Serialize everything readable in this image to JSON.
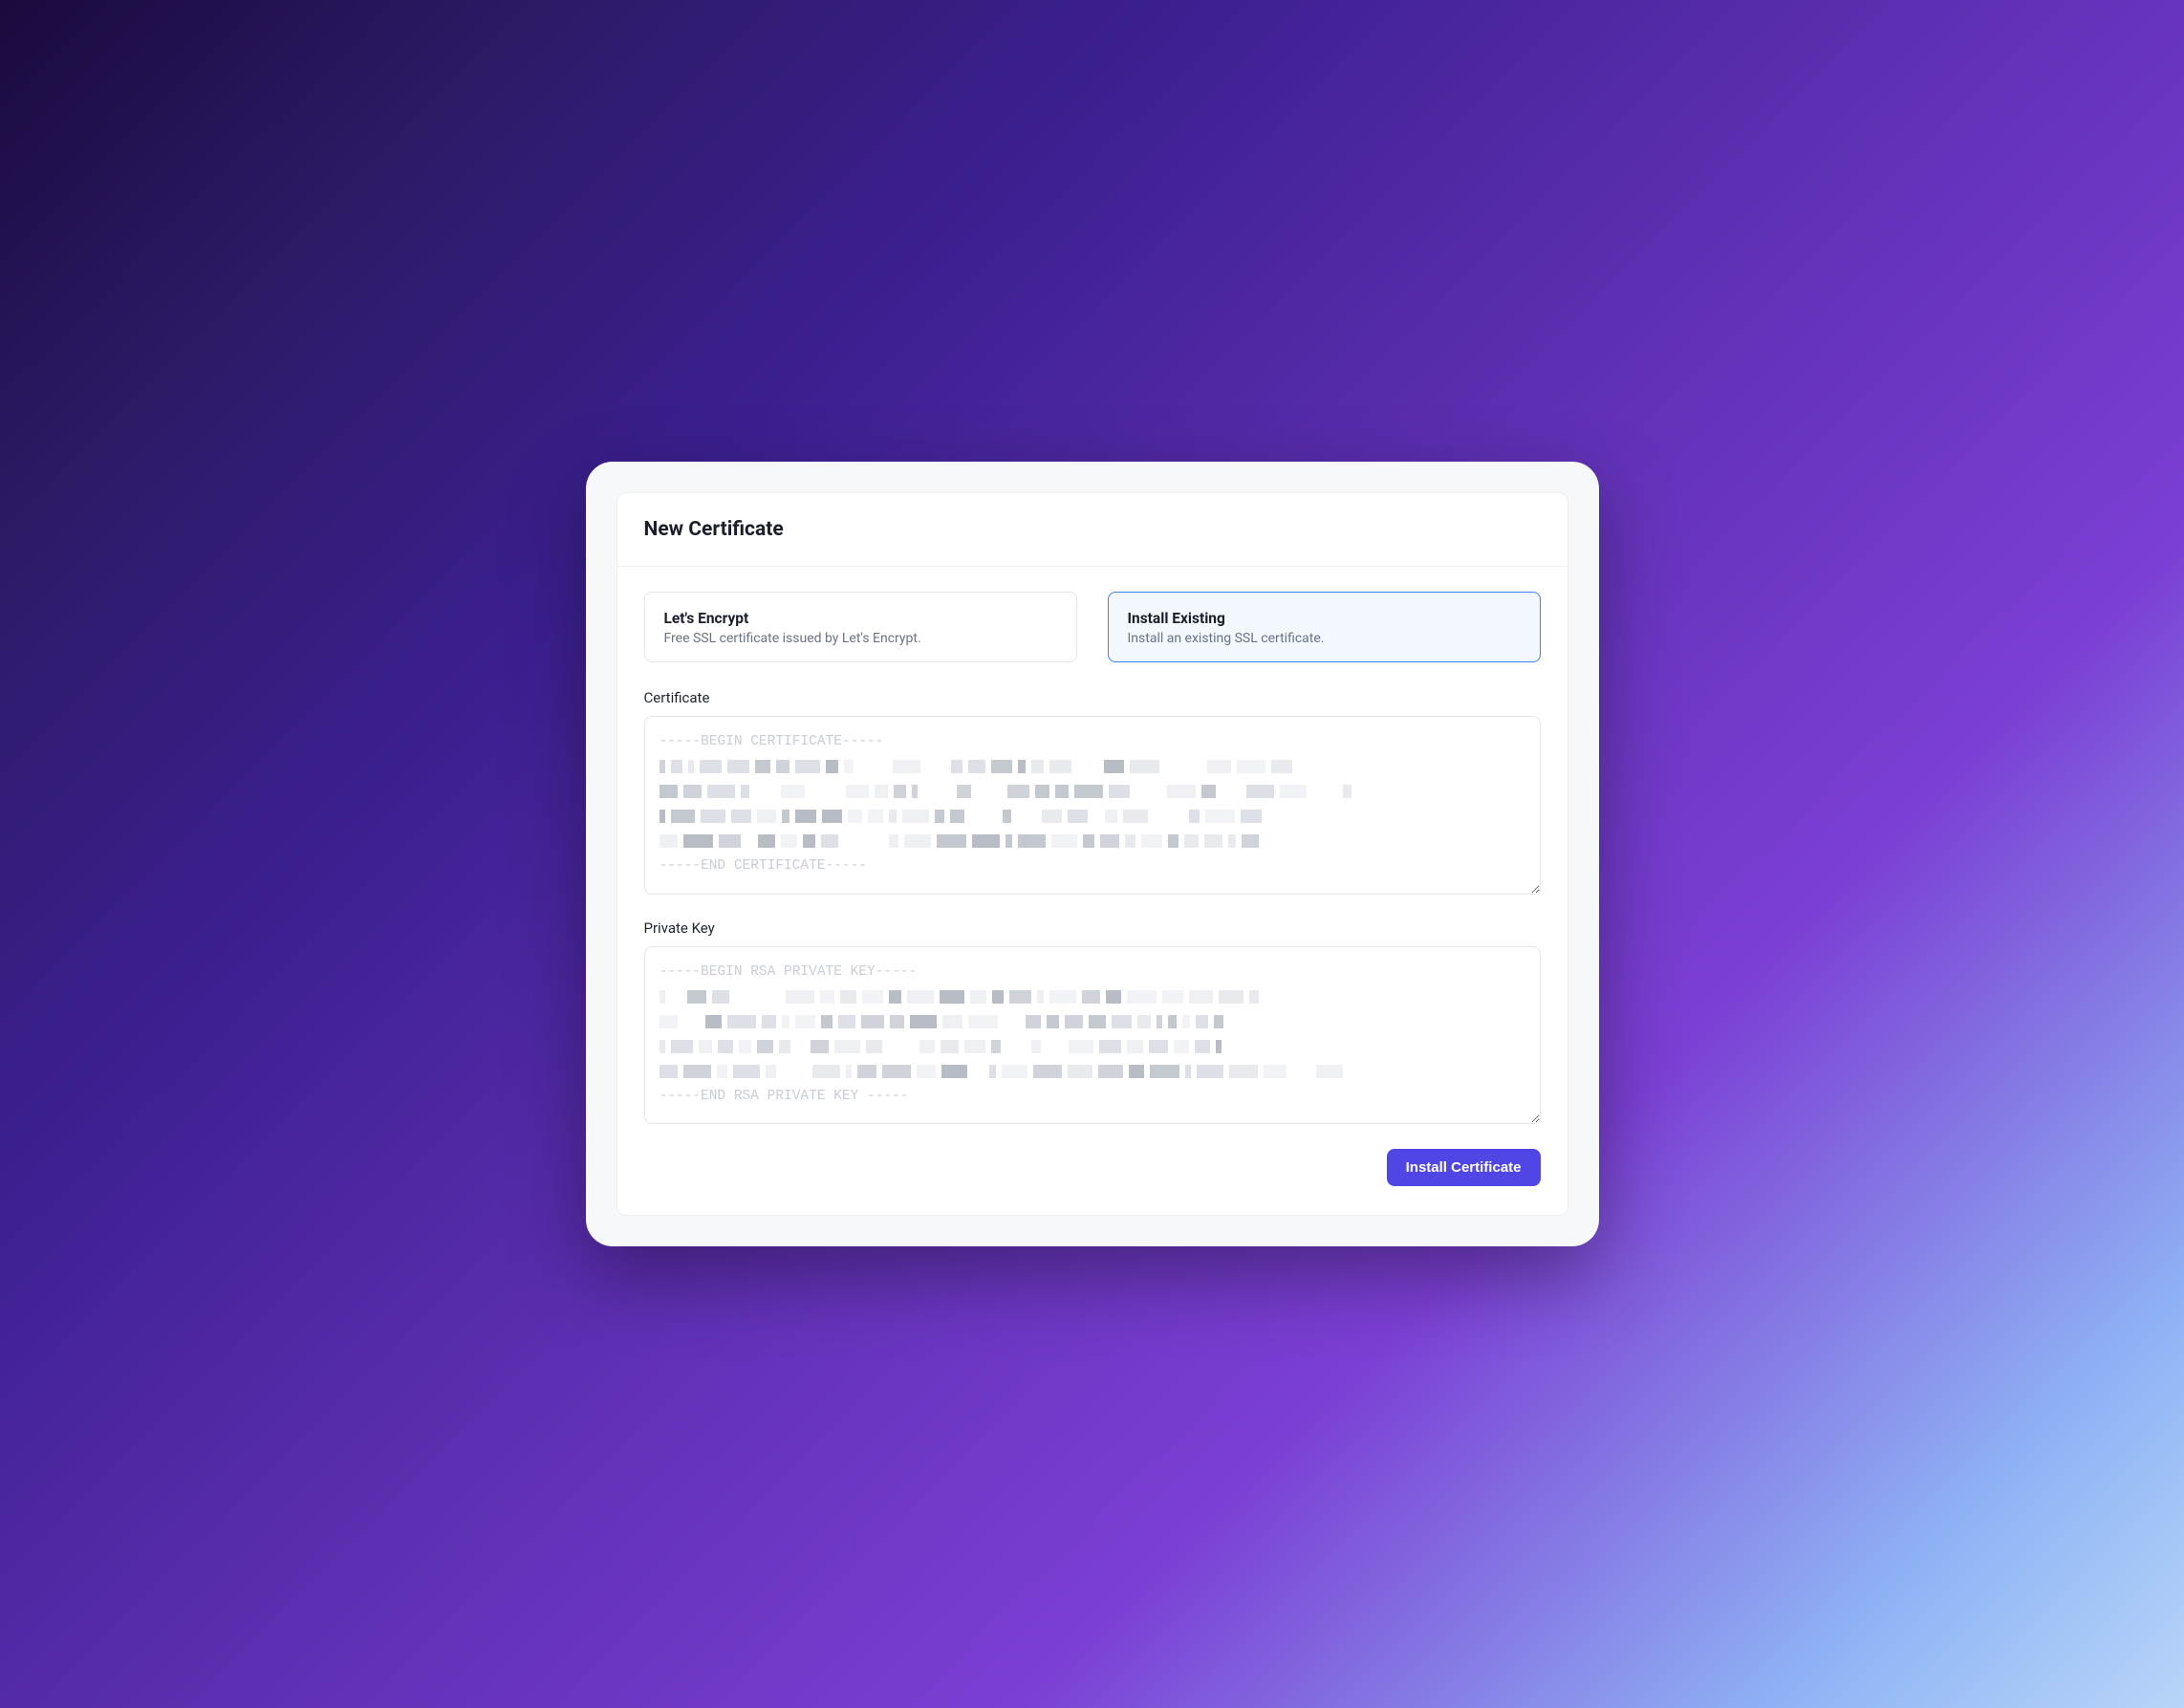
{
  "header": {
    "title": "New Certificate"
  },
  "options": {
    "lets_encrypt": {
      "title": "Let's Encrypt",
      "desc": "Free SSL certificate issued by Let's Encrypt."
    },
    "install_existing": {
      "title": "Install Existing",
      "desc": "Install an existing SSL certificate."
    }
  },
  "fields": {
    "certificate": {
      "label": "Certificate",
      "placeholder_begin": "-----BEGIN CERTIFICATE-----",
      "placeholder_end": "-----END CERTIFICATE-----",
      "value": ""
    },
    "private_key": {
      "label": "Private Key",
      "placeholder_begin": "-----BEGIN RSA PRIVATE KEY-----",
      "placeholder_end": "-----END RSA PRIVATE KEY -----",
      "value": ""
    }
  },
  "actions": {
    "install": "Install Certificate"
  },
  "colors": {
    "accent": "#4f46e5",
    "option_active_border": "#3b82f6"
  }
}
